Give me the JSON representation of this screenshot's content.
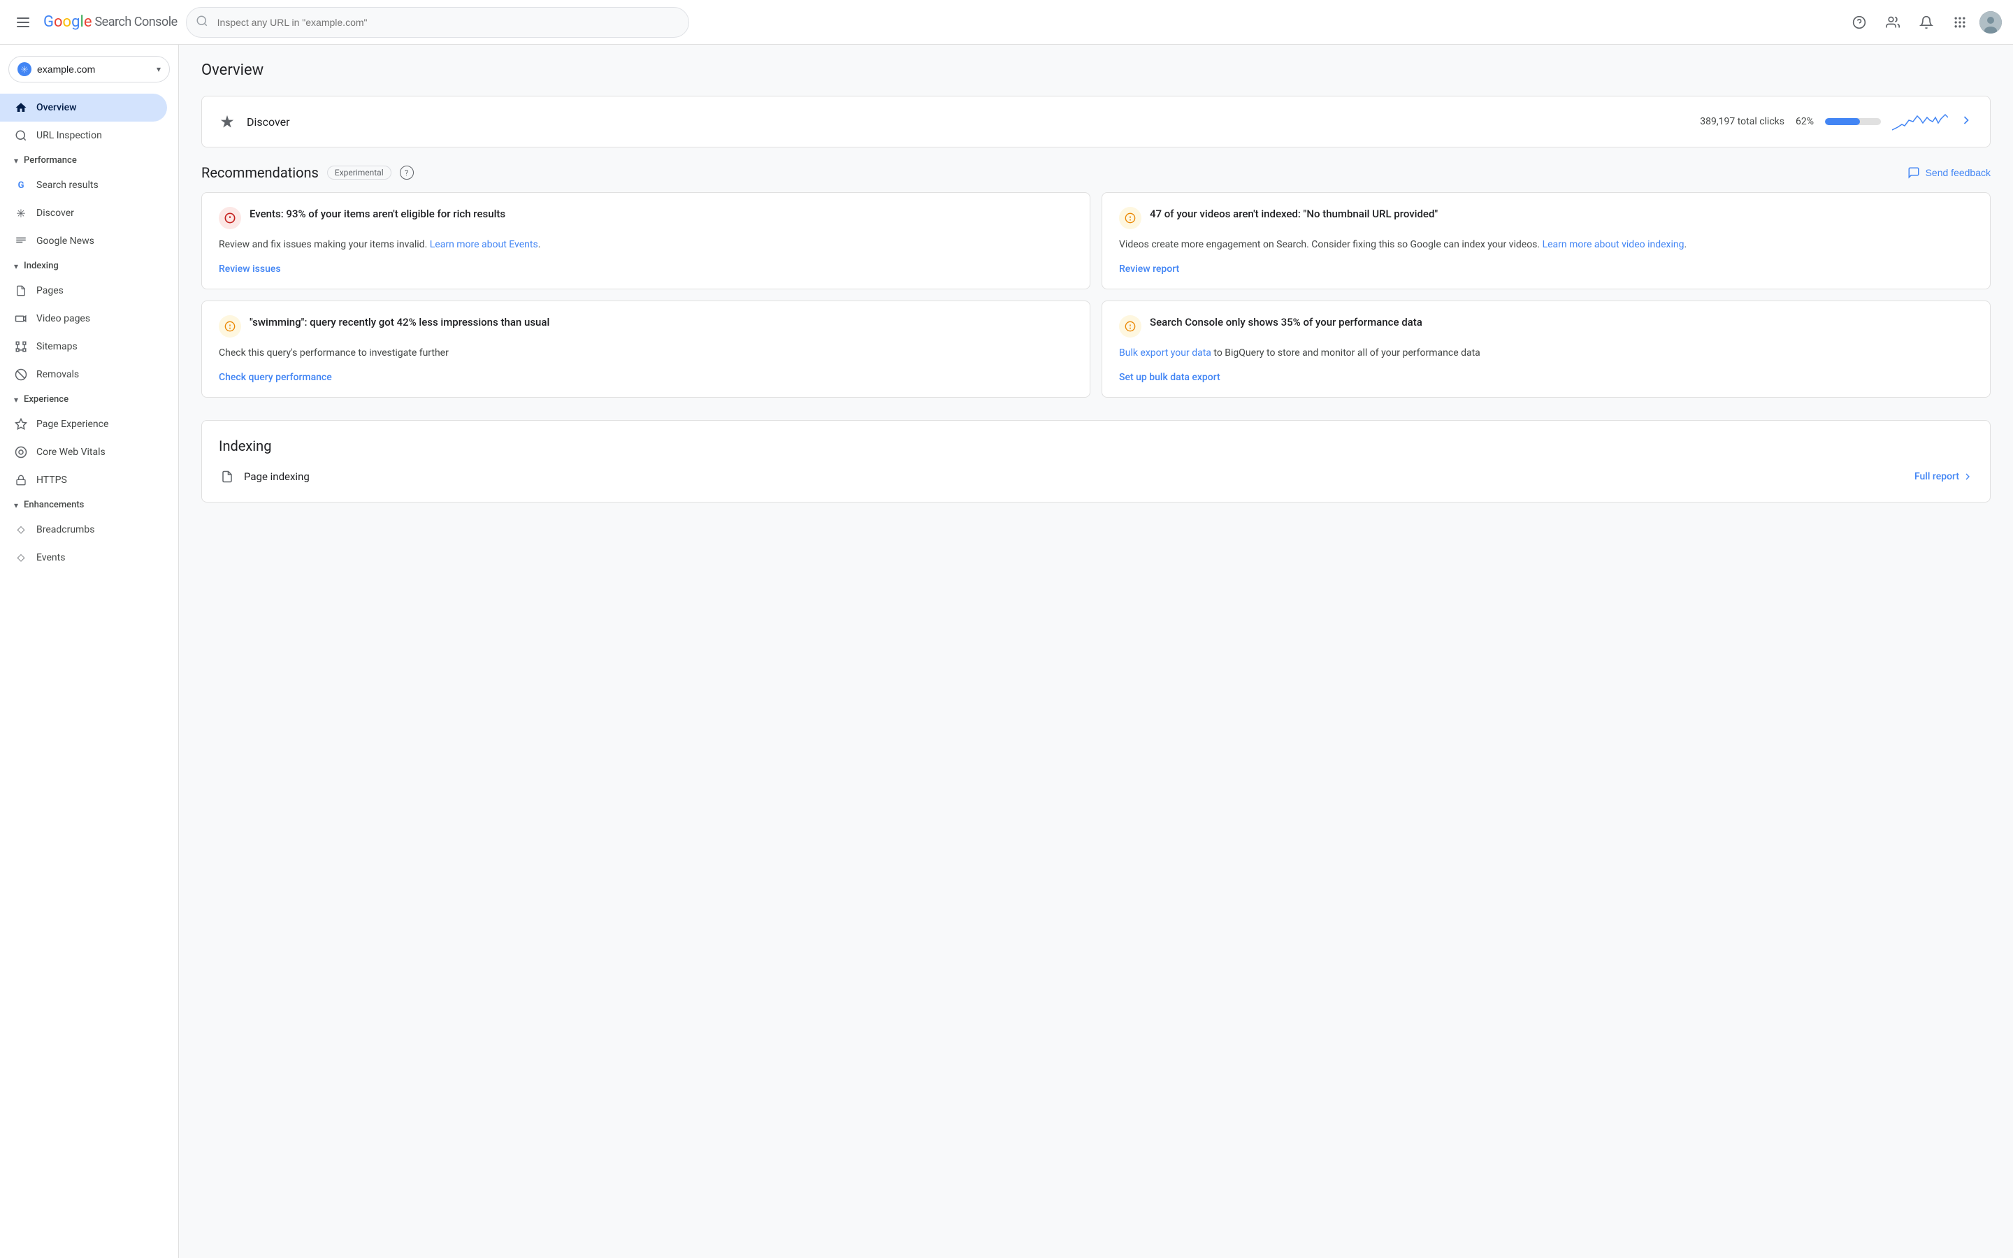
{
  "topbar": {
    "app_name": "Search Console",
    "search_placeholder": "Inspect any URL in \"example.com\"",
    "logo": {
      "g": "G",
      "o1": "o",
      "o2": "o",
      "g2": "g",
      "l": "l",
      "e": "e"
    }
  },
  "sidebar": {
    "property": {
      "name": "example.com",
      "icon": "🌐"
    },
    "nav": [
      {
        "id": "overview",
        "label": "Overview",
        "icon": "home",
        "active": true,
        "section": null
      },
      {
        "id": "url-inspection",
        "label": "URL Inspection",
        "icon": "search",
        "active": false,
        "section": null
      },
      {
        "id": "performance-header",
        "label": "Performance",
        "type": "section"
      },
      {
        "id": "search-results",
        "label": "Search results",
        "icon": "G",
        "active": false,
        "section": "performance"
      },
      {
        "id": "discover",
        "label": "Discover",
        "icon": "✳",
        "active": false,
        "section": "performance"
      },
      {
        "id": "google-news",
        "label": "Google News",
        "icon": "≡",
        "active": false,
        "section": "performance"
      },
      {
        "id": "indexing-header",
        "label": "Indexing",
        "type": "section"
      },
      {
        "id": "pages",
        "label": "Pages",
        "icon": "📄",
        "active": false,
        "section": "indexing"
      },
      {
        "id": "video-pages",
        "label": "Video pages",
        "icon": "▶",
        "active": false,
        "section": "indexing"
      },
      {
        "id": "sitemaps",
        "label": "Sitemaps",
        "icon": "🗺",
        "active": false,
        "section": "indexing"
      },
      {
        "id": "removals",
        "label": "Removals",
        "icon": "🚫",
        "active": false,
        "section": "indexing"
      },
      {
        "id": "experience-header",
        "label": "Experience",
        "type": "section"
      },
      {
        "id": "page-experience",
        "label": "Page Experience",
        "icon": "⭐",
        "active": false,
        "section": "experience"
      },
      {
        "id": "core-web-vitals",
        "label": "Core Web Vitals",
        "icon": "◎",
        "active": false,
        "section": "experience"
      },
      {
        "id": "https",
        "label": "HTTPS",
        "icon": "🔒",
        "active": false,
        "section": "experience"
      },
      {
        "id": "enhancements-header",
        "label": "Enhancements",
        "type": "section"
      },
      {
        "id": "breadcrumbs",
        "label": "Breadcrumbs",
        "icon": "◇",
        "active": false,
        "section": "enhancements"
      },
      {
        "id": "events",
        "label": "Events",
        "icon": "◇",
        "active": false,
        "section": "enhancements"
      }
    ]
  },
  "main": {
    "page_title": "Overview",
    "discover_card": {
      "label": "Discover",
      "total_clicks": "389,197 total clicks",
      "percent": "62%",
      "progress_value": 62
    },
    "recommendations": {
      "title": "Recommendations",
      "badge": "Experimental",
      "send_feedback": "Send feedback",
      "cards": [
        {
          "id": "events-card",
          "icon_type": "error",
          "title": "Events: 93% of your items aren't eligible for rich results",
          "body": "Review and fix issues making your items invalid.",
          "link_text": "Learn more about Events",
          "action_text": "Review issues"
        },
        {
          "id": "videos-card",
          "icon_type": "warn",
          "title": "47 of your videos aren't indexed: \"No thumbnail URL provided\"",
          "body": "Videos create more engagement on Search. Consider fixing this so Google can index your videos.",
          "link_text": "Learn more about video indexing",
          "action_text": "Review report"
        },
        {
          "id": "swimming-card",
          "icon_type": "warn",
          "title": "\"swimming\": query recently got 42% less impressions than usual",
          "body": "Check this query's performance to investigate further",
          "link_text": "",
          "action_text": "Check query performance"
        },
        {
          "id": "bulk-export-card",
          "icon_type": "warn",
          "title": "Search Console only shows 35% of your performance data",
          "body": "to BigQuery to store and monitor all of your performance data",
          "link_text": "Bulk export your data",
          "action_text": "Set up bulk data export"
        }
      ]
    },
    "indexing": {
      "title": "Indexing",
      "page_indexing_label": "Page indexing",
      "full_report": "Full report"
    }
  }
}
